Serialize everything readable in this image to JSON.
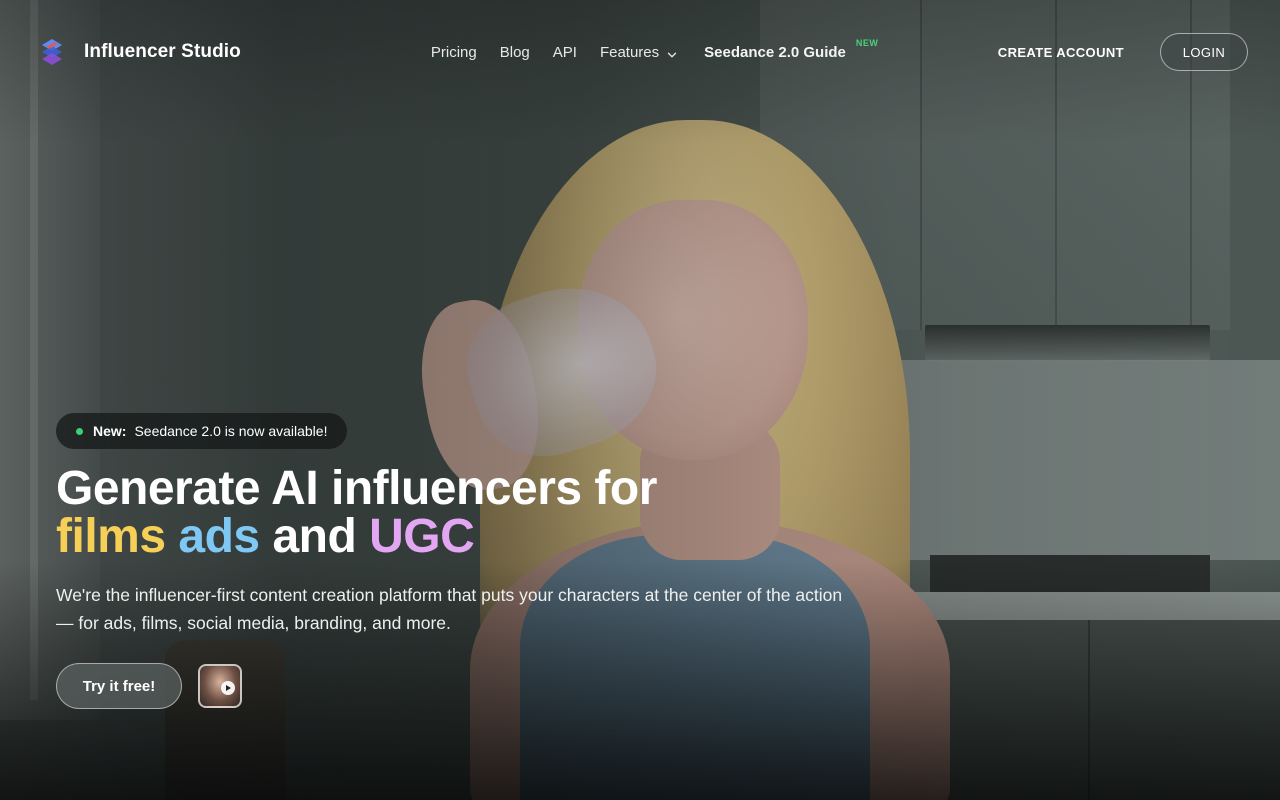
{
  "brand": {
    "name": "Influencer Studio",
    "logo_icon": "stacked-s-logo-icon"
  },
  "nav": {
    "pricing": "Pricing",
    "blog": "Blog",
    "api": "API",
    "features": "Features",
    "features_icon": "chevron-down-icon",
    "guide": "Seedance 2.0 Guide",
    "guide_badge": "NEW"
  },
  "header_actions": {
    "create_account": "CREATE ACCOUNT",
    "login": "LOGIN"
  },
  "hero": {
    "announcement_label": "New:",
    "announcement_text": "Seedance 2.0 is now available!",
    "headline_line1": "Generate AI influencers for",
    "headline_word_films": "films",
    "headline_word_ads": "ads",
    "headline_word_and": "and",
    "headline_word_ugc": "UGC",
    "subtext": "We're the influencer-first content creation platform that puts your characters at the center of the action — for ads, films, social media, branding, and more.",
    "cta_label": "Try it free!",
    "video_icon": "play-icon"
  },
  "colors": {
    "films": "#f6cf57",
    "ads": "#80c8f4",
    "ugc": "#e3a6f2",
    "status_dot": "#3ecf74",
    "new_badge": "#4ad17a"
  }
}
